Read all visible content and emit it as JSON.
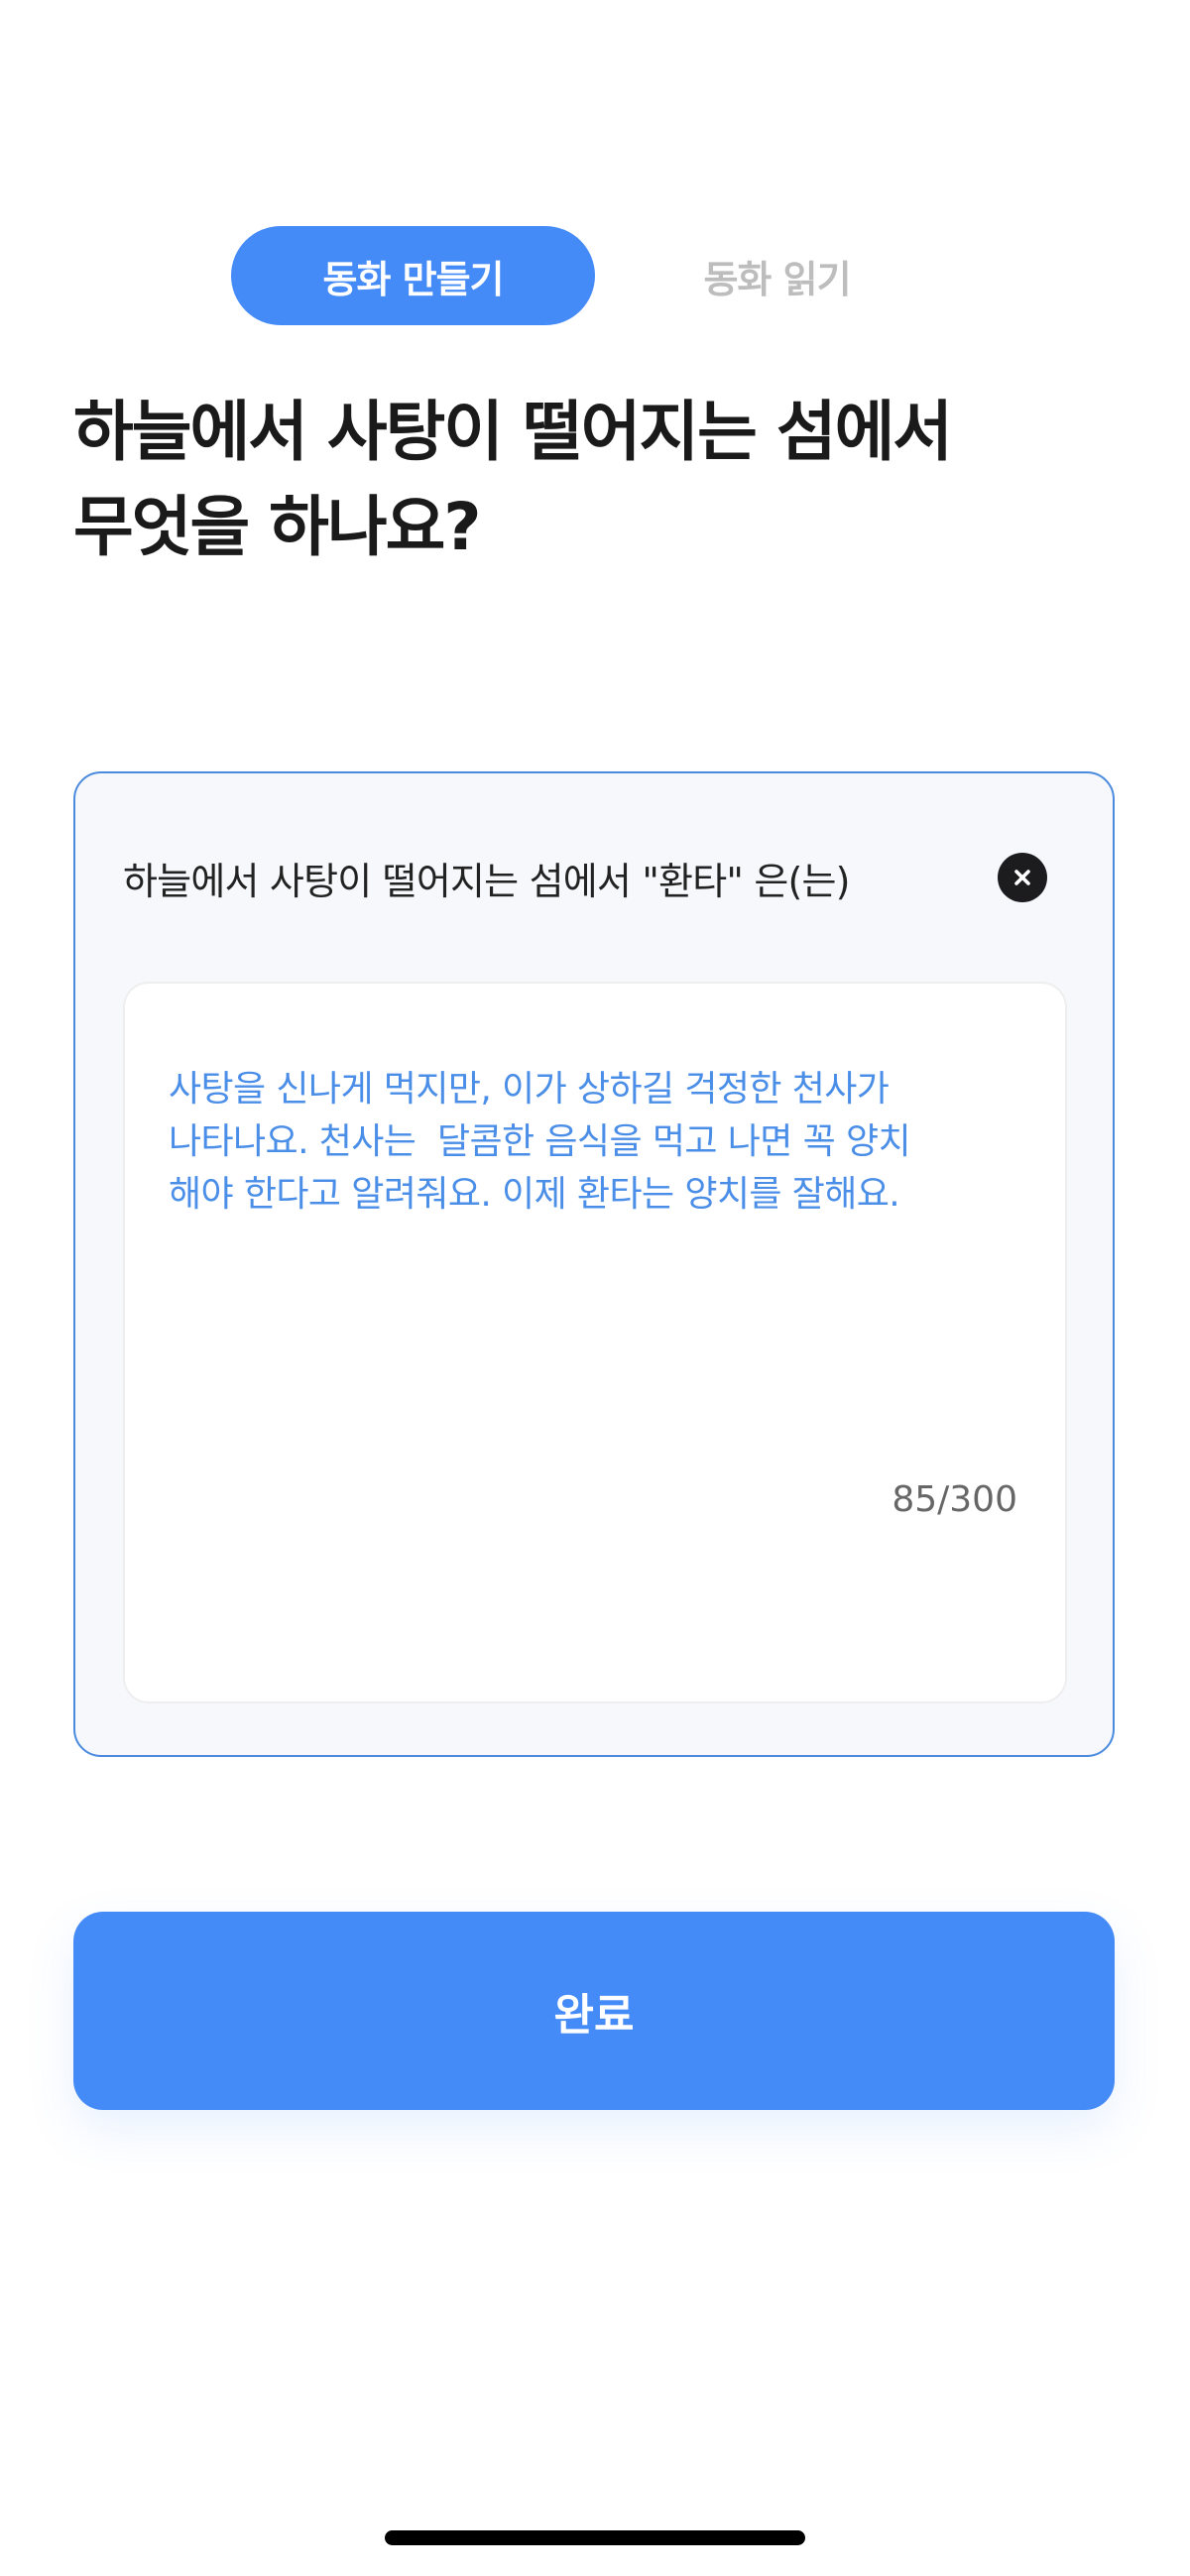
{
  "tabs": {
    "create_label": "동화 만들기",
    "read_label": "동화 읽기"
  },
  "question": {
    "line1": "하늘에서 사탕이 떨어지는 섬에서",
    "line2": "무엇을 하나요?"
  },
  "card": {
    "prompt": "하늘에서 사탕이 떨어지는 섬에서 \"환타\" 은(는)",
    "close_icon": "close-icon",
    "answer_text": "사탕을 신나게 먹지만, 이가 상하길 걱정한 천사가\n나타나요. 천사는  달콤한 음식을 먹고 나면 꼭 양치\n해야 한다고 알려줘요. 이제 환타는 양치를 잘해요.",
    "counter": "85/300"
  },
  "done_button": {
    "label": "완료"
  },
  "colors": {
    "accent": "#448bf8",
    "answer_text": "#4a8ee8",
    "card_border": "#4a8bdf",
    "inactive_tab": "#bdbdbd"
  }
}
